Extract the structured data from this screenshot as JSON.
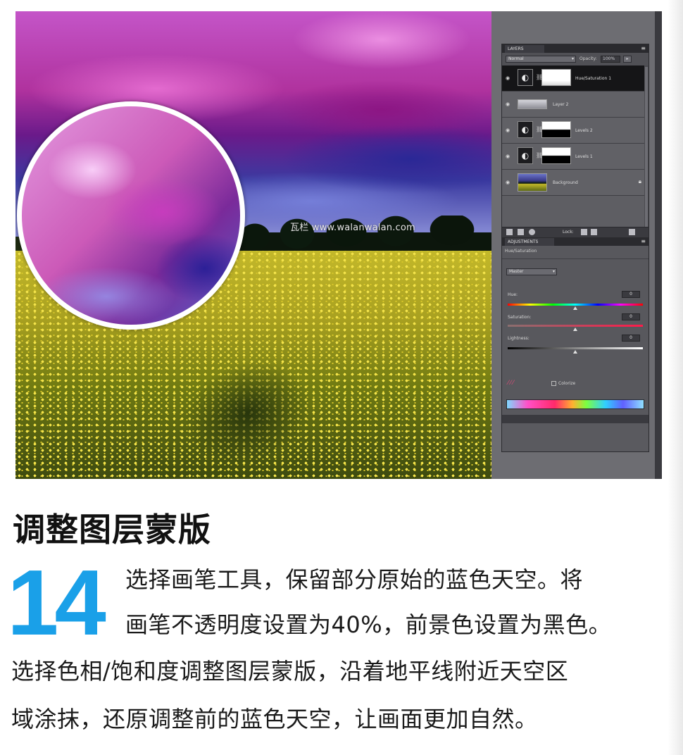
{
  "photo": {
    "watermark": "瓦栏 www.walanwalan.com"
  },
  "layers_panel": {
    "tab_label": "LAYERS",
    "menu_icon": "panel-menu-icon",
    "blend_mode": "Normal",
    "opacity_label": "Opacity:",
    "opacity_value": "100%",
    "layers": [
      {
        "name": "Hue/Saturation 1",
        "type": "adjustment",
        "mask": "white",
        "selected": true
      },
      {
        "name": "Layer 2",
        "type": "pixel",
        "selected": false
      },
      {
        "name": "Levels 2",
        "type": "adjustment",
        "mask": "bw",
        "selected": false
      },
      {
        "name": "Levels 1",
        "type": "adjustment",
        "mask": "bw",
        "selected": false
      },
      {
        "name": "Background",
        "type": "photo",
        "locked": true,
        "selected": false
      }
    ],
    "toolbar_text": "Lock:"
  },
  "adjustments_panel": {
    "tab_label": "ADJUSTMENTS",
    "subtitle": "Hue/Saturation",
    "channel": "Master",
    "sliders": [
      {
        "label": "Hue:",
        "value": "0"
      },
      {
        "label": "Saturation:",
        "value": "0"
      },
      {
        "label": "Lightness:",
        "value": "0"
      }
    ],
    "colorize_label": "Colorize"
  },
  "article": {
    "heading": "调整图层蒙版",
    "step_number": "14",
    "lines": [
      "选择画笔工具，保留部分原始的蓝色天空。将",
      "画笔不透明度设置为40%，前景色设置为黑色。",
      "选择色相/饱和度调整图层蒙版，沿着地平线附近天空区",
      "域涂抹，还原调整前的蓝色天空，让画面更加自然。"
    ]
  }
}
